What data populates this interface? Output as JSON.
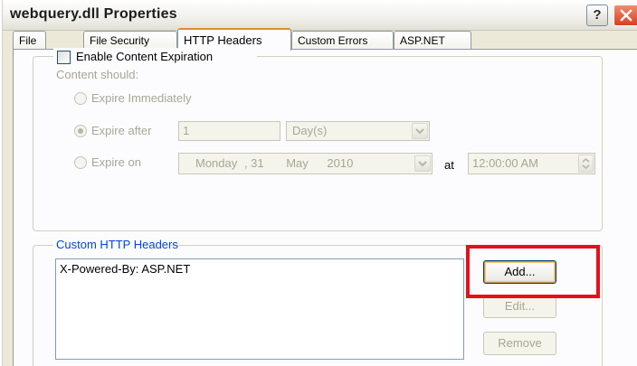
{
  "window": {
    "title": "webquery.dll Properties"
  },
  "title_buttons": {
    "help_label": "?",
    "close_icon": "close-x-icon"
  },
  "tabs": [
    {
      "label": "File",
      "active": false
    },
    {
      "label": "File Security",
      "active": false
    },
    {
      "label": "HTTP Headers",
      "active": true
    },
    {
      "label": "Custom Errors",
      "active": false
    },
    {
      "label": "ASP.NET",
      "active": false
    }
  ],
  "content_expiration": {
    "checkbox_label": "Enable Content Expiration",
    "checked": false,
    "content_should_label": "Content should:",
    "options": {
      "expire_immediately": "Expire Immediately",
      "expire_after": "Expire after",
      "expire_on": "Expire on"
    },
    "selected_option": "expire_after",
    "after_value": "1",
    "after_unit": "Day(s)",
    "date": {
      "weekday": "Monday",
      "day": ", 31",
      "month": "May",
      "year": "2010"
    },
    "at_label": "at",
    "time": "12:00:00 AM"
  },
  "custom_headers": {
    "group_label": "Custom HTTP Headers",
    "items": [
      "X-Powered-By: ASP.NET"
    ],
    "buttons": {
      "add": "Add...",
      "edit": "Edit...",
      "remove": "Remove"
    }
  },
  "colors": {
    "highlight": "#e4111b",
    "active_tab_accent": "#e68b2c",
    "group_label_blue": "#0046d5",
    "disabled_text": "#a7a697"
  }
}
